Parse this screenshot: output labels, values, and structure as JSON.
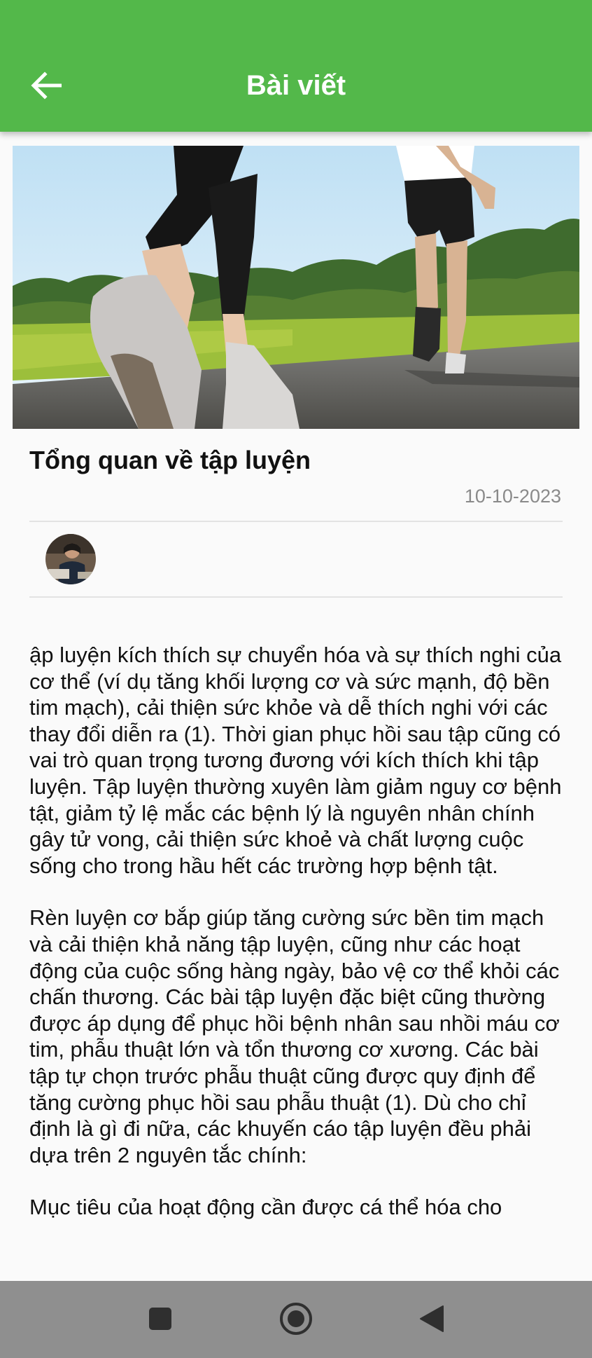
{
  "appbar": {
    "title": "Bài viết",
    "back_icon": "arrow-left-icon",
    "background": "#53b84a"
  },
  "article": {
    "image_description": "runners-on-road-photo",
    "title": "Tổng quan về tập luyện",
    "date": "10-10-2023",
    "author_avatar": "author-avatar-photo",
    "paragraphs": [
      "ập luyện kích thích sự chuyển hóa và sự thích nghi của cơ thể (ví dụ tăng khối lượng cơ và sức mạnh, độ bền tim mạch), cải thiện sức khỏe và dễ thích nghi với các thay đổi diễn ra (1). Thời gian phục hồi sau tập cũng có vai trò quan trọng tương đương với kích thích khi tập luyện. Tập luyện thường xuyên làm giảm nguy cơ bệnh tật, giảm tỷ lệ mắc các bệnh lý là nguyên nhân chính gây tử vong, cải thiện sức khoẻ và chất lượng cuộc sống cho trong hầu hết các trường hợp bệnh tật.",
      "Rèn luyện cơ bắp giúp tăng cường sức bền tim mạch và cải thiện khả năng tập luyện, cũng như các hoạt động của cuộc sống hàng ngày, bảo vệ cơ thể khỏi các chấn thương. Các bài tập luyện đặc biệt cũng thường được áp dụng để phục hồi bệnh nhân sau nhồi máu cơ tim, phẫu thuật lớn và tổn thương cơ xương. Các bài tập tự chọn trước phẫu thuật cũng được quy định để tăng cường phục hồi sau phẫu thuật (1). Dù cho chỉ định là gì đi nữa, các khuyến cáo tập luyện đều phải dựa trên 2 nguyên tắc chính:",
      "Mục tiêu của hoạt động cần được cá thể hóa cho"
    ]
  },
  "navbar": {
    "recents_icon": "square-recents-icon",
    "home_icon": "circle-home-icon",
    "back_icon": "triangle-back-icon"
  }
}
